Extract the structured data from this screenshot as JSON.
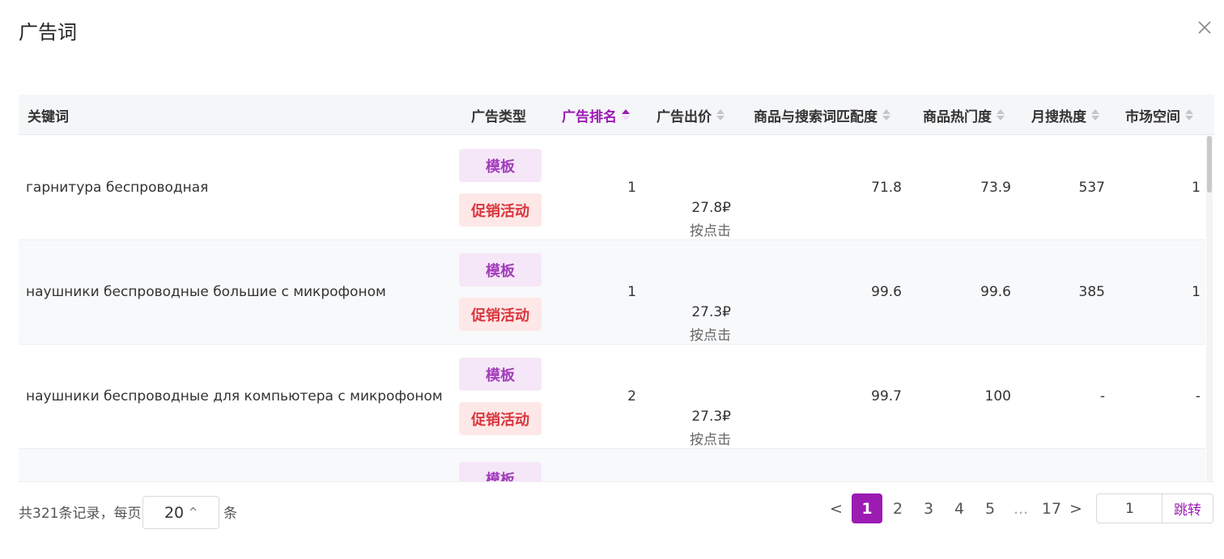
{
  "modal": {
    "title": "广告词"
  },
  "table": {
    "columns": {
      "keyword": "关键词",
      "ad_type": "广告类型",
      "ad_rank": "广告排名",
      "ad_bid": "广告出价",
      "match": "商品与搜索词匹配度",
      "popularity": "商品热门度",
      "monthly_search": "月搜热度",
      "market_space": "市场空间"
    },
    "rows": [
      {
        "keyword": "гарнитура беспроводная",
        "tag1": "模板",
        "tag2": "促销活动",
        "rank": "1",
        "bid": "27.8₽",
        "bid_unit": "按点击",
        "match": "71.8",
        "popularity": "73.9",
        "monthly": "537",
        "market": "1"
      },
      {
        "keyword": "наушники беспроводные большие с микрофоном",
        "tag1": "模板",
        "tag2": "促销活动",
        "rank": "1",
        "bid": "27.3₽",
        "bid_unit": "按点击",
        "match": "99.6",
        "popularity": "99.6",
        "monthly": "385",
        "market": "1"
      },
      {
        "keyword": "наушники беспроводные для компьютера с микрофоном",
        "tag1": "模板",
        "tag2": "促销活动",
        "rank": "2",
        "bid": "27.3₽",
        "bid_unit": "按点击",
        "match": "99.7",
        "popularity": "100",
        "monthly": "-",
        "market": "-"
      },
      {
        "keyword": "",
        "tag1": "模板",
        "tag2": "",
        "rank": "",
        "bid": "",
        "bid_unit": "",
        "match": "",
        "popularity": "",
        "monthly": "",
        "market": ""
      }
    ]
  },
  "pagination": {
    "total_text": "共321条记录，每页",
    "page_size": "20",
    "unit": "条",
    "prev": "<",
    "next": ">",
    "pages": [
      "1",
      "2",
      "3",
      "4",
      "5",
      "...",
      "17"
    ],
    "current": "1",
    "jump_value": "1",
    "jump_label": "跳转"
  },
  "colors": {
    "accent": "#9c1bb3",
    "tag_template_bg": "#f6e7f8",
    "tag_template_fg": "#a23cbc",
    "tag_promo_bg": "#fde8e7",
    "tag_promo_fg": "#d9363e"
  },
  "icons": {
    "close": "close-icon",
    "sort": "sort-icon",
    "caret": "chevron-up-icon"
  }
}
